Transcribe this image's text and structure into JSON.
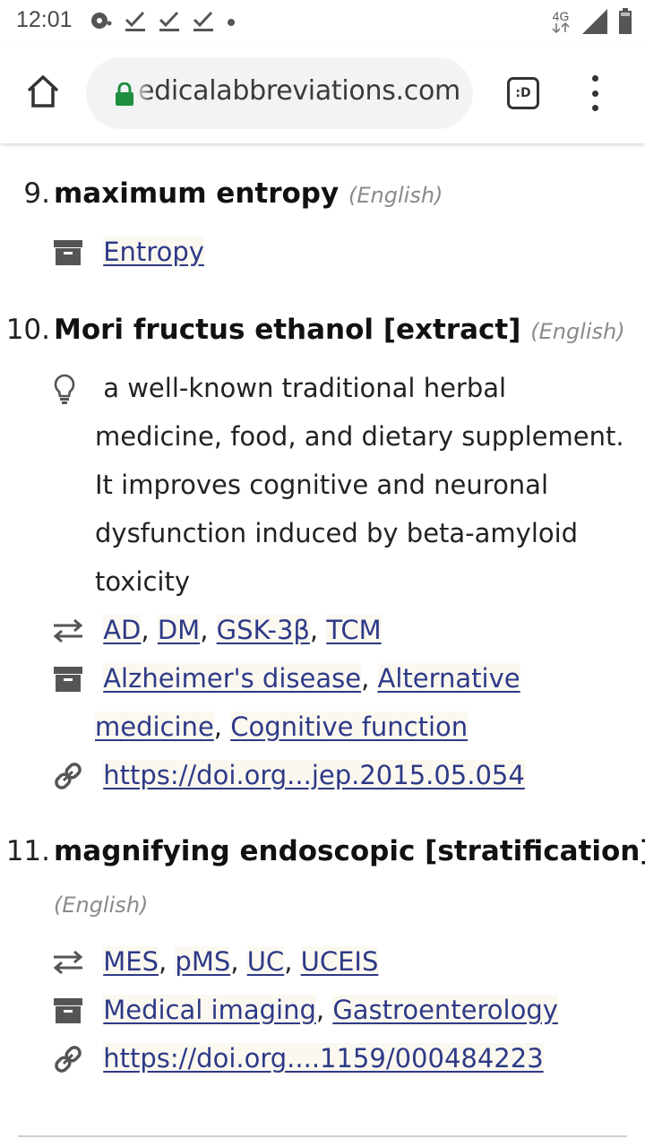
{
  "status_bar": {
    "time": "12:01",
    "network": "4G"
  },
  "browser": {
    "url": "edicalabbreviations.com",
    "tab_icon_label": ":D"
  },
  "entries": [
    {
      "number": "9.",
      "term": "maximum entropy",
      "lang": "(English)",
      "categories": [
        "Entropy"
      ]
    },
    {
      "number": "10.",
      "term": "Mori fructus ethanol [extract]",
      "lang": "(English)",
      "description": "a well-known traditional herbal medicine, food, and dietary supplement. It improves cognitive and neuronal dysfunction induced by beta-amyloid toxicity",
      "synonyms": [
        "AD",
        "DM",
        "GSK-3β",
        "TCM"
      ],
      "categories": [
        "Alzheimer's disease",
        "Alternative medicine",
        "Cognitive function"
      ],
      "link": "https://doi.org...jep.2015.05.054"
    },
    {
      "number": "11.",
      "term": "magnifying endoscopic [stratification]",
      "lang": "(English)",
      "synonyms": [
        "MES",
        "pMS",
        "UC",
        "UCEIS"
      ],
      "categories": [
        "Medical imaging",
        "Gastroenterology"
      ],
      "link": "https://doi.org....1159/000484223"
    }
  ],
  "icons": {
    "home": "home-icon",
    "lock": "lock-icon",
    "menu": "more-vert-icon",
    "category": "archive-box-icon",
    "synonym": "swap-arrows-icon",
    "description": "lightbulb-icon",
    "link": "link-icon"
  },
  "colors": {
    "link": "#2e3a87",
    "lock": "#1e8e3e",
    "url_bar_bg": "#f1f3f4"
  }
}
